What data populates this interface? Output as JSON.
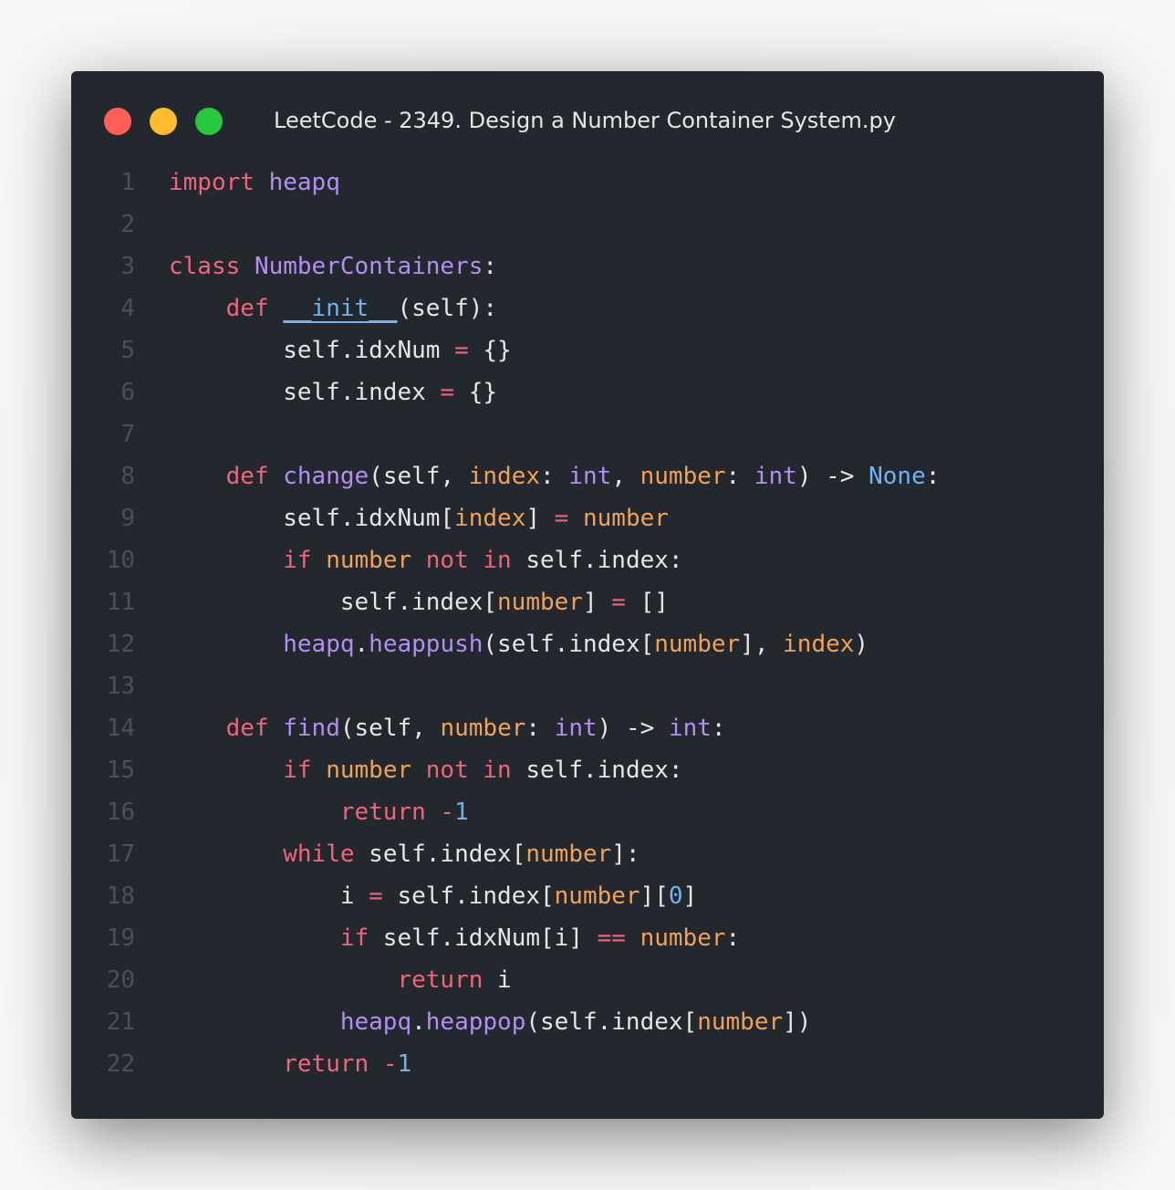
{
  "window": {
    "title": "LeetCode - 2349. Design a Number Container System.py",
    "buttons": [
      {
        "name": "close",
        "color": "#fe5f57"
      },
      {
        "name": "minimize",
        "color": "#febc2e"
      },
      {
        "name": "maximize",
        "color": "#28c840"
      }
    ]
  },
  "colors": {
    "background": "#23272e",
    "keyword": "#f0657a",
    "class_function": "#b48ef0",
    "parameter": "#f0a25b",
    "constant": "#6fb3f2",
    "text": "#e6e6e6",
    "line_number": "#4b5058"
  },
  "code": {
    "language": "python",
    "lines": [
      {
        "n": "1",
        "tokens": [
          {
            "t": "import",
            "c": "kw"
          },
          {
            "t": " ",
            "c": "plain"
          },
          {
            "t": "heapq",
            "c": "cls"
          }
        ]
      },
      {
        "n": "2",
        "tokens": []
      },
      {
        "n": "3",
        "tokens": [
          {
            "t": "class",
            "c": "kw"
          },
          {
            "t": " ",
            "c": "plain"
          },
          {
            "t": "NumberContainers",
            "c": "cls"
          },
          {
            "t": ":",
            "c": "plain"
          }
        ]
      },
      {
        "n": "4",
        "tokens": [
          {
            "t": "    ",
            "c": "plain"
          },
          {
            "t": "def",
            "c": "kw"
          },
          {
            "t": " ",
            "c": "plain"
          },
          {
            "t": "__init__",
            "c": "dunder"
          },
          {
            "t": "(self):",
            "c": "plain"
          }
        ]
      },
      {
        "n": "5",
        "tokens": [
          {
            "t": "        self.idxNum ",
            "c": "plain"
          },
          {
            "t": "=",
            "c": "op"
          },
          {
            "t": " {}",
            "c": "plain"
          }
        ]
      },
      {
        "n": "6",
        "tokens": [
          {
            "t": "        self.index ",
            "c": "plain"
          },
          {
            "t": "=",
            "c": "op"
          },
          {
            "t": " {}",
            "c": "plain"
          }
        ]
      },
      {
        "n": "7",
        "tokens": []
      },
      {
        "n": "8",
        "tokens": [
          {
            "t": "    ",
            "c": "plain"
          },
          {
            "t": "def",
            "c": "kw"
          },
          {
            "t": " ",
            "c": "plain"
          },
          {
            "t": "change",
            "c": "fn"
          },
          {
            "t": "(self, ",
            "c": "plain"
          },
          {
            "t": "index",
            "c": "param"
          },
          {
            "t": ": ",
            "c": "plain"
          },
          {
            "t": "int",
            "c": "builtin"
          },
          {
            "t": ", ",
            "c": "plain"
          },
          {
            "t": "number",
            "c": "param"
          },
          {
            "t": ": ",
            "c": "plain"
          },
          {
            "t": "int",
            "c": "builtin"
          },
          {
            "t": ") -> ",
            "c": "plain"
          },
          {
            "t": "None",
            "c": "none"
          },
          {
            "t": ":",
            "c": "plain"
          }
        ]
      },
      {
        "n": "9",
        "tokens": [
          {
            "t": "        self.idxNum[",
            "c": "plain"
          },
          {
            "t": "index",
            "c": "param"
          },
          {
            "t": "] ",
            "c": "plain"
          },
          {
            "t": "=",
            "c": "op"
          },
          {
            "t": " ",
            "c": "plain"
          },
          {
            "t": "number",
            "c": "param"
          }
        ]
      },
      {
        "n": "10",
        "tokens": [
          {
            "t": "        ",
            "c": "plain"
          },
          {
            "t": "if",
            "c": "kw"
          },
          {
            "t": " ",
            "c": "plain"
          },
          {
            "t": "number",
            "c": "param"
          },
          {
            "t": " ",
            "c": "plain"
          },
          {
            "t": "not",
            "c": "kw"
          },
          {
            "t": " ",
            "c": "plain"
          },
          {
            "t": "in",
            "c": "kw"
          },
          {
            "t": " self.index:",
            "c": "plain"
          }
        ]
      },
      {
        "n": "11",
        "tokens": [
          {
            "t": "            self.index[",
            "c": "plain"
          },
          {
            "t": "number",
            "c": "param"
          },
          {
            "t": "] ",
            "c": "plain"
          },
          {
            "t": "=",
            "c": "op"
          },
          {
            "t": " []",
            "c": "plain"
          }
        ]
      },
      {
        "n": "12",
        "tokens": [
          {
            "t": "        ",
            "c": "plain"
          },
          {
            "t": "heapq",
            "c": "cls"
          },
          {
            "t": ".",
            "c": "plain"
          },
          {
            "t": "heappush",
            "c": "fn"
          },
          {
            "t": "(self.index[",
            "c": "plain"
          },
          {
            "t": "number",
            "c": "param"
          },
          {
            "t": "], ",
            "c": "plain"
          },
          {
            "t": "index",
            "c": "param"
          },
          {
            "t": ")",
            "c": "plain"
          }
        ]
      },
      {
        "n": "13",
        "tokens": []
      },
      {
        "n": "14",
        "tokens": [
          {
            "t": "    ",
            "c": "plain"
          },
          {
            "t": "def",
            "c": "kw"
          },
          {
            "t": " ",
            "c": "plain"
          },
          {
            "t": "find",
            "c": "fn"
          },
          {
            "t": "(self, ",
            "c": "plain"
          },
          {
            "t": "number",
            "c": "param"
          },
          {
            "t": ": ",
            "c": "plain"
          },
          {
            "t": "int",
            "c": "builtin"
          },
          {
            "t": ") -> ",
            "c": "plain"
          },
          {
            "t": "int",
            "c": "builtin"
          },
          {
            "t": ":",
            "c": "plain"
          }
        ]
      },
      {
        "n": "15",
        "tokens": [
          {
            "t": "        ",
            "c": "plain"
          },
          {
            "t": "if",
            "c": "kw"
          },
          {
            "t": " ",
            "c": "plain"
          },
          {
            "t": "number",
            "c": "param"
          },
          {
            "t": " ",
            "c": "plain"
          },
          {
            "t": "not",
            "c": "kw"
          },
          {
            "t": " ",
            "c": "plain"
          },
          {
            "t": "in",
            "c": "kw"
          },
          {
            "t": " self.index:",
            "c": "plain"
          }
        ]
      },
      {
        "n": "16",
        "tokens": [
          {
            "t": "            ",
            "c": "plain"
          },
          {
            "t": "return",
            "c": "kw"
          },
          {
            "t": " ",
            "c": "plain"
          },
          {
            "t": "-",
            "c": "op"
          },
          {
            "t": "1",
            "c": "num"
          }
        ]
      },
      {
        "n": "17",
        "tokens": [
          {
            "t": "        ",
            "c": "plain"
          },
          {
            "t": "while",
            "c": "kw"
          },
          {
            "t": " self.index[",
            "c": "plain"
          },
          {
            "t": "number",
            "c": "param"
          },
          {
            "t": "]:",
            "c": "plain"
          }
        ]
      },
      {
        "n": "18",
        "tokens": [
          {
            "t": "            i ",
            "c": "plain"
          },
          {
            "t": "=",
            "c": "op"
          },
          {
            "t": " self.index[",
            "c": "plain"
          },
          {
            "t": "number",
            "c": "param"
          },
          {
            "t": "][",
            "c": "plain"
          },
          {
            "t": "0",
            "c": "num"
          },
          {
            "t": "]",
            "c": "plain"
          }
        ]
      },
      {
        "n": "19",
        "tokens": [
          {
            "t": "            ",
            "c": "plain"
          },
          {
            "t": "if",
            "c": "kw"
          },
          {
            "t": " self.idxNum[i] ",
            "c": "plain"
          },
          {
            "t": "==",
            "c": "op"
          },
          {
            "t": " ",
            "c": "plain"
          },
          {
            "t": "number",
            "c": "param"
          },
          {
            "t": ":",
            "c": "plain"
          }
        ]
      },
      {
        "n": "20",
        "tokens": [
          {
            "t": "                ",
            "c": "plain"
          },
          {
            "t": "return",
            "c": "kw"
          },
          {
            "t": " i",
            "c": "plain"
          }
        ]
      },
      {
        "n": "21",
        "tokens": [
          {
            "t": "            ",
            "c": "plain"
          },
          {
            "t": "heapq",
            "c": "cls"
          },
          {
            "t": ".",
            "c": "plain"
          },
          {
            "t": "heappop",
            "c": "fn"
          },
          {
            "t": "(self.index[",
            "c": "plain"
          },
          {
            "t": "number",
            "c": "param"
          },
          {
            "t": "])",
            "c": "plain"
          }
        ]
      },
      {
        "n": "22",
        "tokens": [
          {
            "t": "        ",
            "c": "plain"
          },
          {
            "t": "return",
            "c": "kw"
          },
          {
            "t": " ",
            "c": "plain"
          },
          {
            "t": "-",
            "c": "op"
          },
          {
            "t": "1",
            "c": "num"
          }
        ]
      }
    ]
  }
}
